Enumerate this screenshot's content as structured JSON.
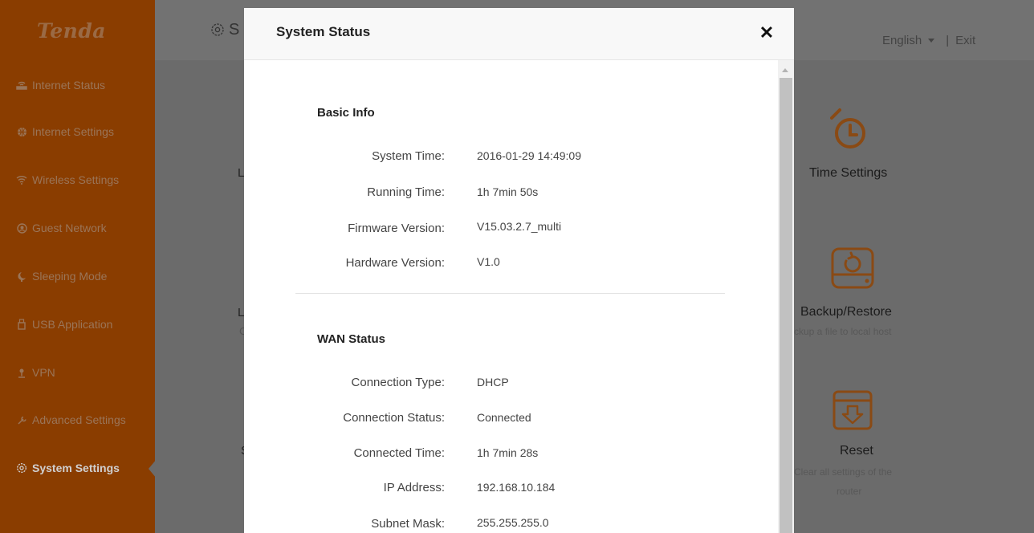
{
  "brand": {
    "logo": "Tenda"
  },
  "sidebar": {
    "items": [
      {
        "label": "Internet Status",
        "icon": "router-icon"
      },
      {
        "label": "Internet Settings",
        "icon": "globe-icon"
      },
      {
        "label": "Wireless Settings",
        "icon": "wifi-icon"
      },
      {
        "label": "Guest Network",
        "icon": "guest-icon"
      },
      {
        "label": "Sleeping Mode",
        "icon": "moon-icon"
      },
      {
        "label": "USB Application",
        "icon": "usb-icon"
      },
      {
        "label": "VPN",
        "icon": "vpn-icon"
      },
      {
        "label": "Advanced Settings",
        "icon": "wrench-icon"
      },
      {
        "label": "System Settings",
        "icon": "gear-icon",
        "active": true
      }
    ]
  },
  "header": {
    "page_title_partial": "S",
    "language": "English",
    "separator": "|",
    "exit": "Exit"
  },
  "background": {
    "letters": [
      "L",
      "L",
      "C",
      "S"
    ],
    "tiles": [
      {
        "title": "Time Settings",
        "desc": "",
        "icon": "clock-icon"
      },
      {
        "title": "Backup/Restore",
        "desc": "ckup a file to local host",
        "icon": "backup-icon"
      },
      {
        "title": "Reset",
        "desc_line1": "Clear all settings of the",
        "desc_line2": "router",
        "icon": "reset-icon"
      }
    ]
  },
  "modal": {
    "title": "System Status",
    "close_symbol": "✕",
    "basic_info": {
      "title": "Basic Info",
      "rows": [
        {
          "label": "System Time:",
          "value": "2016-01-29 14:49:09"
        },
        {
          "label": "Running Time:",
          "value": "1h 7min 50s"
        },
        {
          "label": "Firmware Version:",
          "value": "V15.03.2.7_multi"
        },
        {
          "label": "Hardware Version:",
          "value": "V1.0"
        }
      ]
    },
    "wan_status": {
      "title": "WAN Status",
      "rows": [
        {
          "label": "Connection Type:",
          "value": "DHCP"
        },
        {
          "label": "Connection Status:",
          "value": "Connected"
        },
        {
          "label": "Connected Time:",
          "value": "1h 7min 28s"
        },
        {
          "label": "IP Address:",
          "value": "192.168.10.184"
        },
        {
          "label": "Subnet Mask:",
          "value": "255.255.255.0"
        }
      ]
    }
  },
  "colors": {
    "sidebar_bg_dimmed": "#8a3d00",
    "overlay_bg": "#6b6b6b",
    "accent_orange_dimmed": "#8a4a14"
  }
}
